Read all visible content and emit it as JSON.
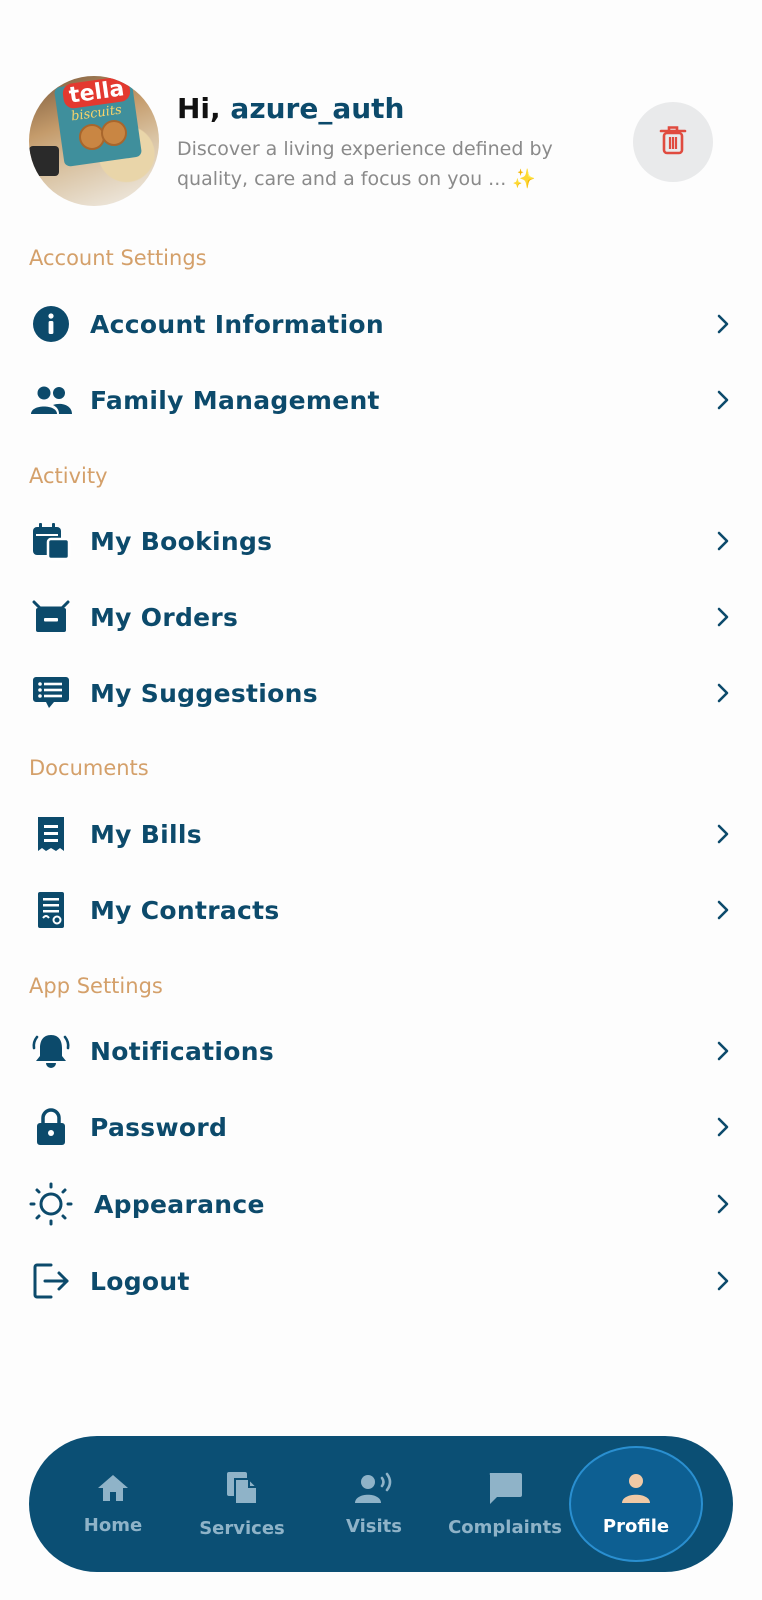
{
  "header": {
    "greeting": "Hi,",
    "username": "azure_auth",
    "subtitle": "Discover a living experience defined by quality, care and a focus on you ... ✨",
    "avatar_brand": "tella",
    "avatar_sub": "biscuits",
    "delete_icon": "trash-icon"
  },
  "sections": {
    "account": {
      "title": "Account Settings",
      "items": [
        {
          "label": "Account Information",
          "icon": "info-icon"
        },
        {
          "label": "Family Management",
          "icon": "people-icon"
        }
      ]
    },
    "activity": {
      "title": "Activity",
      "items": [
        {
          "label": "My Bookings",
          "icon": "calendar-icon"
        },
        {
          "label": "My Orders",
          "icon": "basket-icon"
        },
        {
          "label": "My Suggestions",
          "icon": "suggestion-icon"
        }
      ]
    },
    "documents": {
      "title": "Documents",
      "items": [
        {
          "label": "My Bills",
          "icon": "receipt-icon"
        },
        {
          "label": "My Contracts",
          "icon": "contract-icon"
        }
      ]
    },
    "app": {
      "title": "App Settings",
      "items": [
        {
          "label": "Notifications",
          "icon": "bell-icon"
        },
        {
          "label": "Password",
          "icon": "lock-icon"
        },
        {
          "label": "Appearance",
          "icon": "sun-icon"
        },
        {
          "label": "Logout",
          "icon": "logout-icon"
        }
      ]
    }
  },
  "nav": {
    "items": [
      {
        "label": "Home",
        "icon": "home-icon"
      },
      {
        "label": "Services",
        "icon": "copy-icon"
      },
      {
        "label": "Visits",
        "icon": "person-voice-icon"
      },
      {
        "label": "Complaints",
        "icon": "chat-icon"
      },
      {
        "label": "Profile",
        "icon": "person-icon",
        "active": true
      }
    ]
  },
  "colors": {
    "primary": "#0c4a6b",
    "section_title": "#d4a06a",
    "navbar": "#0b4f74",
    "nav_active": "#0d5f92",
    "delete": "#e04b3f"
  }
}
